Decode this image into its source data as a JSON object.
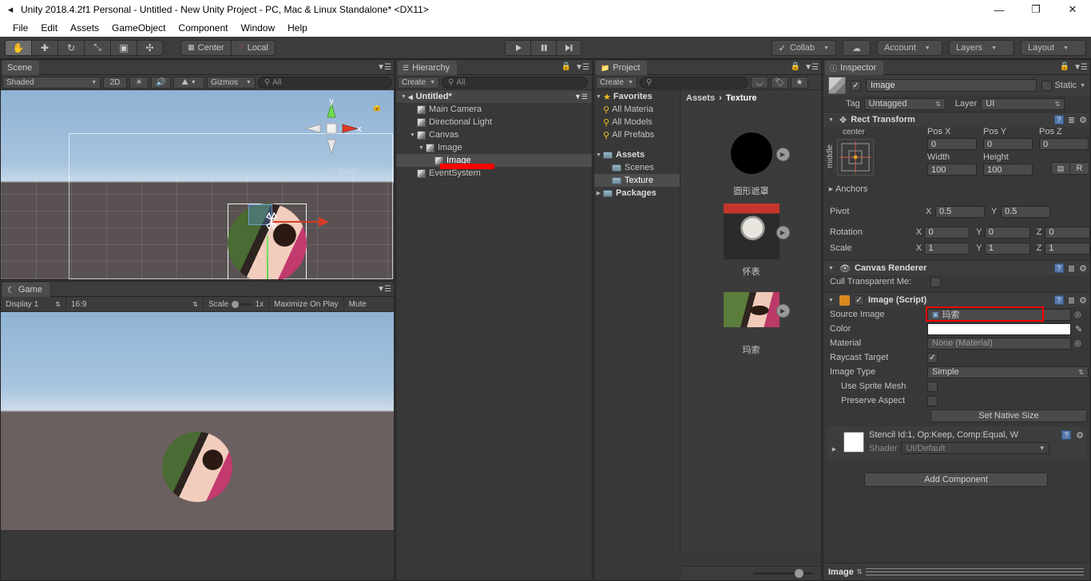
{
  "window": {
    "title": "Unity 2018.4.2f1 Personal - Untitled - New Unity Project - PC, Mac & Linux Standalone* <DX11>",
    "app_icon": "unity-icon",
    "minimize": "—",
    "maximize": "❐",
    "close": "✕"
  },
  "menu": {
    "items": [
      "File",
      "Edit",
      "Assets",
      "GameObject",
      "Component",
      "Window",
      "Help"
    ]
  },
  "toolbar": {
    "transform_tools": [
      {
        "name": "hand-tool",
        "glyph": "✋",
        "active": true
      },
      {
        "name": "move-tool",
        "glyph": "✚",
        "active": false
      },
      {
        "name": "rotate-tool",
        "glyph": "↻",
        "active": false
      },
      {
        "name": "scale-tool",
        "glyph": "⤡",
        "active": false
      },
      {
        "name": "rect-tool",
        "glyph": "▣",
        "active": false
      },
      {
        "name": "transform-tool",
        "glyph": "✣",
        "active": false
      }
    ],
    "pivot_mode": "Center",
    "pivot_rotation": "Local",
    "play": "▶",
    "pause": "‖",
    "step": "▶|",
    "collab": "Collab",
    "cloud": "cloud-icon",
    "account": "Account",
    "layers": "Layers",
    "layout": "Layout"
  },
  "scene": {
    "tab": "Scene",
    "draw_mode": "Shaded",
    "two_d": "2D",
    "lighting": "light-icon",
    "audio": "audio-icon",
    "effects": "fx-icon",
    "gizmos": "Gizmos",
    "search_placeholder": "All",
    "gizmo_axis_labels": {
      "y": "y",
      "x": "x"
    },
    "view_label": "Back"
  },
  "game": {
    "tab": "Game",
    "display": "Display 1",
    "aspect": "16:9",
    "scale_label": "Scale",
    "scale_value": "1x",
    "maximize_on_play": "Maximize On Play",
    "mute": "Mute"
  },
  "hierarchy": {
    "tab": "Hierarchy",
    "create": "Create",
    "search_placeholder": "All",
    "scene_name": "Untitled*",
    "items": [
      {
        "label": "Main Camera",
        "depth": 1,
        "expandable": false,
        "selected": false
      },
      {
        "label": "Directional Light",
        "depth": 1,
        "expandable": false,
        "selected": false
      },
      {
        "label": "Canvas",
        "depth": 1,
        "expandable": true,
        "selected": false
      },
      {
        "label": "Image",
        "depth": 2,
        "expandable": true,
        "selected": false
      },
      {
        "label": "Image",
        "depth": 3,
        "expandable": false,
        "selected": true
      },
      {
        "label": "EventSystem",
        "depth": 1,
        "expandable": false,
        "selected": false
      }
    ]
  },
  "project": {
    "tab": "Project",
    "create": "Create",
    "search_placeholder": "",
    "breadcrumb": [
      "Assets",
      "Texture"
    ],
    "breadcrumb_sep": "›",
    "tree": [
      {
        "label": "Favorites",
        "type": "star",
        "depth": 0,
        "expandable": true,
        "selected": false
      },
      {
        "label": "All Materia",
        "type": "search",
        "depth": 1,
        "expandable": false,
        "selected": false
      },
      {
        "label": "All Models",
        "type": "search",
        "depth": 1,
        "expandable": false,
        "selected": false
      },
      {
        "label": "All Prefabs",
        "type": "search",
        "depth": 1,
        "expandable": false,
        "selected": false
      },
      {
        "label": "Assets",
        "type": "folder",
        "depth": 0,
        "expandable": true,
        "selected": false
      },
      {
        "label": "Scenes",
        "type": "folder",
        "depth": 1,
        "expandable": false,
        "selected": false
      },
      {
        "label": "Texture",
        "type": "folder",
        "depth": 1,
        "expandable": false,
        "selected": true
      },
      {
        "label": "Packages",
        "type": "folder",
        "depth": 0,
        "expandable": true,
        "selected": false
      }
    ],
    "assets": [
      {
        "label": "圆形遮罩",
        "kind": "circle-mask"
      },
      {
        "label": "怀表",
        "kind": "pocket-watch"
      },
      {
        "label": "玛索",
        "kind": "portrait"
      }
    ]
  },
  "inspector": {
    "tab": "Inspector",
    "object_name": "Image",
    "enabled": true,
    "static_label": "Static",
    "tag_label": "Tag",
    "tag_value": "Untagged",
    "layer_label": "Layer",
    "layer_value": "UI",
    "rect_transform": {
      "title": "Rect Transform",
      "anchor_preset_h": "center",
      "anchor_preset_v": "middle",
      "pos_x_label": "Pos X",
      "pos_x": "0",
      "pos_y_label": "Pos Y",
      "pos_y": "0",
      "pos_z_label": "Pos Z",
      "pos_z": "0",
      "width_label": "Width",
      "width": "100",
      "height_label": "Height",
      "height": "100",
      "blueprint_btn": "blueprint-icon",
      "raw_btn": "R",
      "anchors_label": "Anchors",
      "pivot_label": "Pivot",
      "pivot_x": "0.5",
      "pivot_y": "0.5",
      "rotation_label": "Rotation",
      "rot_x": "0",
      "rot_y": "0",
      "rot_z": "0",
      "scale_label": "Scale",
      "scale_x": "1",
      "scale_y": "1",
      "scale_z": "1"
    },
    "canvas_renderer": {
      "title": "Canvas Renderer",
      "cull_label": "Cull Transparent Me:",
      "cull_checked": false
    },
    "image_script": {
      "title": "Image (Script)",
      "enabled": true,
      "source_image_label": "Source Image",
      "source_image_value": "玛索",
      "color_label": "Color",
      "color_value": "#FFFFFF",
      "material_label": "Material",
      "material_value": "None (Material)",
      "raycast_label": "Raycast Target",
      "raycast_checked": true,
      "image_type_label": "Image Type",
      "image_type_value": "Simple",
      "use_sprite_mesh_label": "Use Sprite Mesh",
      "use_sprite_mesh_checked": false,
      "preserve_aspect_label": "Preserve Aspect",
      "preserve_aspect_checked": false,
      "set_native_size": "Set Native Size"
    },
    "material_preview": {
      "title": "Stencil Id:1, Op:Keep, Comp:Equal, W",
      "shader_label": "Shader",
      "shader_value": "UI/Default"
    },
    "add_component": "Add Component",
    "footer_label": "Image"
  },
  "colors": {
    "highlight_red": "#ff0000",
    "selection": "#4d4d4d",
    "panel_bg": "#383838",
    "toolbar_bg": "#3c3c3c"
  }
}
